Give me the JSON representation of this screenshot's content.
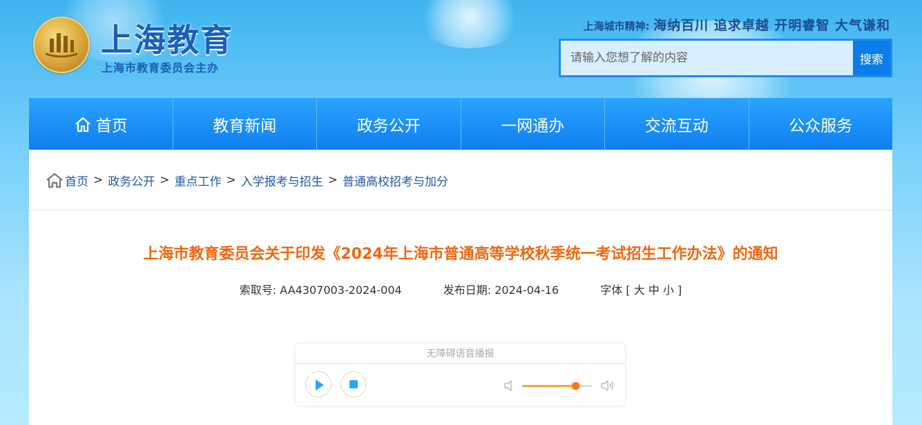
{
  "site": {
    "title": "上海教育",
    "subtitle": "上海市教育委员会主办",
    "slogan_label": "上海城市精神:",
    "slogan_text": "海纳百川 追求卓越 开明睿智 大气谦和"
  },
  "search": {
    "placeholder": "请输入您想了解的内容",
    "button_label": "搜索"
  },
  "nav": {
    "items": [
      {
        "label": "首页",
        "icon": "home-icon"
      },
      {
        "label": "教育新闻"
      },
      {
        "label": "政务公开"
      },
      {
        "label": "一网通办"
      },
      {
        "label": "交流互动"
      },
      {
        "label": "公众服务"
      }
    ]
  },
  "breadcrumb": {
    "items": [
      "首页",
      "政务公开",
      "重点工作",
      "入学报考与招生",
      "普通高校招考与加分"
    ],
    "separator": ">"
  },
  "article": {
    "title": "上海市教育委员会关于印发《2024年上海市普通高等学校秋季统一考试招生工作办法》的通知",
    "index_label": "索取号:",
    "index_value": "AA4307003-2024-004",
    "date_label": "发布日期:",
    "date_value": "2024-04-16",
    "font_label": "字体 [",
    "font_large": "大",
    "font_medium": "中",
    "font_small": "小",
    "font_close": "]"
  },
  "player": {
    "title": "无障碍语音播报",
    "volume": 0.75,
    "accent_color": "#21a9f2",
    "volume_color": "#f77a0c"
  },
  "colors": {
    "nav_bg": "#0f7ef0",
    "title_orange": "#f0670f",
    "link_blue": "#1d5aa6"
  }
}
